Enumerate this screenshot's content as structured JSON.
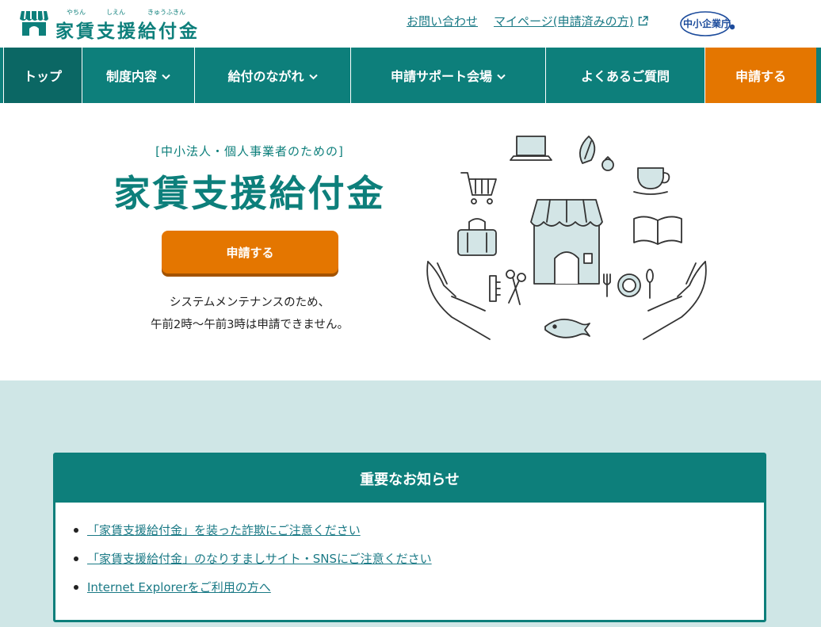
{
  "header": {
    "logo_title": "家賃支援給付金",
    "logo_ruby": [
      "やちん",
      "しえん",
      "きゅうふきん"
    ],
    "util_links": [
      {
        "label": "お問い合わせ"
      },
      {
        "label": "マイページ(申請済みの方)"
      }
    ],
    "agency_label": "中小企業庁"
  },
  "nav": {
    "items": [
      {
        "label": "トップ",
        "has_dropdown": false
      },
      {
        "label": "制度内容",
        "has_dropdown": true
      },
      {
        "label": "給付のながれ",
        "has_dropdown": true
      },
      {
        "label": "申請サポート会場",
        "has_dropdown": true
      },
      {
        "label": "よくあるご質問",
        "has_dropdown": false
      },
      {
        "label": "申請する",
        "has_dropdown": false
      }
    ]
  },
  "hero": {
    "subtitle": "[中小法人・個人事業者のための]",
    "title": "家賃支援給付金",
    "apply_button": "申請する",
    "note_line1": "システムメンテナンスのため、",
    "note_line2": "午前2時〜午前3時は申請できません。"
  },
  "notice": {
    "heading": "重要なお知らせ",
    "items": [
      {
        "text": "「家賃支援給付金」を装った詐欺にご注意ください"
      },
      {
        "text": "「家賃支援給付金」のなりすましサイト・SNSにご注意ください"
      },
      {
        "text": "Internet Explorerをご利用の方へ"
      }
    ]
  },
  "colors": {
    "brand_teal": "#0d7f7b",
    "nav_active": "#0b6764",
    "accent_orange": "#e47600",
    "section_bg": "#cfe6e6",
    "link": "#1b7a86"
  }
}
